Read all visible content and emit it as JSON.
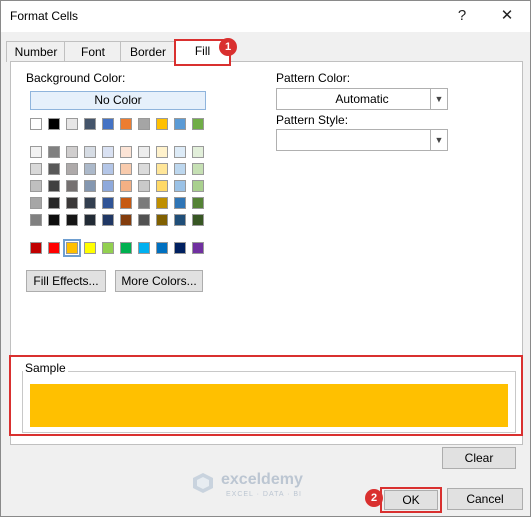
{
  "window": {
    "title": "Format Cells",
    "help_glyph": "?",
    "close_glyph": "✕"
  },
  "tabs": [
    {
      "label": "Number",
      "active": false
    },
    {
      "label": "Font",
      "active": false
    },
    {
      "label": "Border",
      "active": false
    },
    {
      "label": "Fill",
      "active": true
    }
  ],
  "fill": {
    "background_color_label": "Background Color:",
    "no_color_label": "No Color",
    "theme_top_row": [
      "#ffffff",
      "#000000",
      "#e7e6e6",
      "#44546a",
      "#4472c4",
      "#ed7d31",
      "#a5a5a5",
      "#ffc000",
      "#5b9bd5",
      "#70ad47"
    ],
    "theme_shades": [
      [
        "#f2f2f2",
        "#808080",
        "#d0cece",
        "#d6dce4",
        "#d9e1f2",
        "#fce4d6",
        "#ededed",
        "#fff2cc",
        "#ddebf7",
        "#e2efda"
      ],
      [
        "#d9d9d9",
        "#595959",
        "#aeaaaa",
        "#acb9ca",
        "#b4c6e7",
        "#f8cbad",
        "#dbdbdb",
        "#ffe699",
        "#bdd7ee",
        "#c6e0b4"
      ],
      [
        "#bfbfbf",
        "#404040",
        "#757171",
        "#8497b0",
        "#8ea9db",
        "#f4b084",
        "#c9c9c9",
        "#ffd966",
        "#9bc2e6",
        "#a9d08e"
      ],
      [
        "#a6a6a6",
        "#262626",
        "#3a3838",
        "#333f4f",
        "#305496",
        "#c65911",
        "#7b7b7b",
        "#bf8f00",
        "#2f75b5",
        "#548235"
      ],
      [
        "#808080",
        "#0d0d0d",
        "#161616",
        "#222b35",
        "#203764",
        "#833c0c",
        "#525252",
        "#806000",
        "#1f4e78",
        "#375623"
      ]
    ],
    "standard_colors": [
      "#c00000",
      "#ff0000",
      "#ffc000",
      "#ffff00",
      "#92d050",
      "#00b050",
      "#00b0f0",
      "#0070c0",
      "#002060",
      "#7030a0"
    ],
    "selected_standard_color": "#ffc000",
    "fill_effects_label": "Fill Effects...",
    "more_colors_label": "More Colors...",
    "pattern_color_label": "Pattern Color:",
    "pattern_color_value": "Automatic",
    "pattern_style_label": "Pattern Style:",
    "pattern_style_value": "",
    "sample_label": "Sample",
    "sample_color": "#ffc000"
  },
  "buttons": {
    "clear": "Clear",
    "ok": "OK",
    "cancel": "Cancel"
  },
  "annotations": {
    "badge_1": "1",
    "badge_2": "2",
    "highlight_color": "#d9302f"
  },
  "watermark": {
    "name": "exceldemy",
    "tagline": "EXCEL · DATA · BI"
  }
}
